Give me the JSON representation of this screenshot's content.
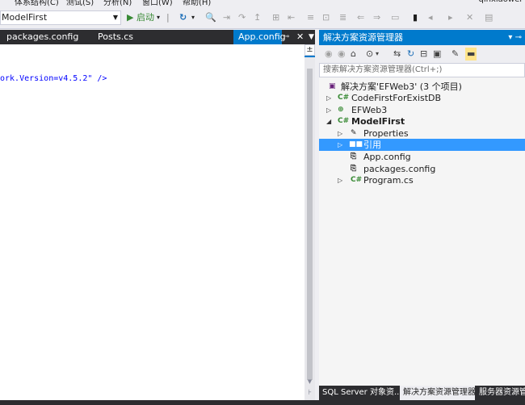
{
  "menubar": {
    "items": [
      "体系结构(C)",
      "测试(S)",
      "分析(N)",
      "窗口(W)",
      "帮助(H)"
    ],
    "user": "qinxiaowei"
  },
  "toolbar": {
    "project_combo": "ModelFirst",
    "start_label": "▶ 启动"
  },
  "tabs": [
    {
      "label": "packages.config"
    },
    {
      "label": "Posts.cs"
    },
    {
      "label": "App.config",
      "active": true
    }
  ],
  "editor": {
    "code_line": "ork.Version=v4.5.2\" />"
  },
  "solution_explorer": {
    "title": "解决方案资源管理器",
    "search_placeholder": "搜索解决方案资源管理器(Ctrl+;)",
    "tree": [
      {
        "label": "解决方案'EFWeb3' (3 个项目)",
        "icon": "solution-icon",
        "expander": ""
      },
      {
        "label": "CodeFirstForExistDB",
        "icon": "csharp-project-icon",
        "expander": "▷"
      },
      {
        "label": "EFWeb3",
        "icon": "web-project-icon",
        "expander": "▷"
      },
      {
        "label": "ModelFirst",
        "icon": "csharp-project-icon",
        "expander": "◢",
        "bold": true
      },
      {
        "label": "Properties",
        "icon": "wrench-icon",
        "expander": "▷"
      },
      {
        "label": "引用",
        "icon": "references-icon",
        "expander": "▷",
        "selected": true
      },
      {
        "label": "App.config",
        "icon": "config-file-icon",
        "expander": ""
      },
      {
        "label": "packages.config",
        "icon": "config-file-icon",
        "expander": ""
      },
      {
        "label": "Program.cs",
        "icon": "csharp-file-icon",
        "expander": "▷"
      }
    ]
  },
  "bottom_tabs": [
    {
      "label": "SQL Server 对象资..."
    },
    {
      "label": "解决方案资源管理器",
      "active": true
    },
    {
      "label": "服务器资源管理器"
    }
  ],
  "colors": {
    "accent": "#007acc",
    "selection": "#3399ff",
    "dark_chrome": "#2d2d30"
  }
}
